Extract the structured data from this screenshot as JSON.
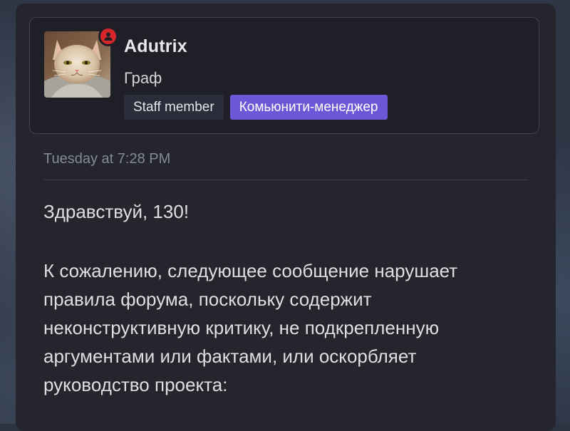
{
  "post": {
    "author": {
      "name": "Adutrix",
      "title": "Граф",
      "avatar_icon": "cat-avatar",
      "status_icon": "user-online-icon",
      "badges": [
        {
          "label": "Staff member",
          "color": "#2b2d3a"
        },
        {
          "label": "Комьюнити-менеджер",
          "color": "#6c58d6"
        }
      ]
    },
    "timestamp": "Tuesday at 7:28 PM",
    "greeting": "Здравствуй, 130!",
    "body_lines": [
      "К сожалению, следующее сообщение нарушает",
      "правила форума, поскольку содержит",
      "неконструктивную критику, не подкрепленную",
      "аргументами или фактами, или оскорбляет",
      "руководство проекта:"
    ]
  },
  "colors": {
    "panel_bg": "#25262d",
    "card_bg": "#1f2027",
    "accent": "#6c58d6",
    "status_red": "#d8262c"
  }
}
